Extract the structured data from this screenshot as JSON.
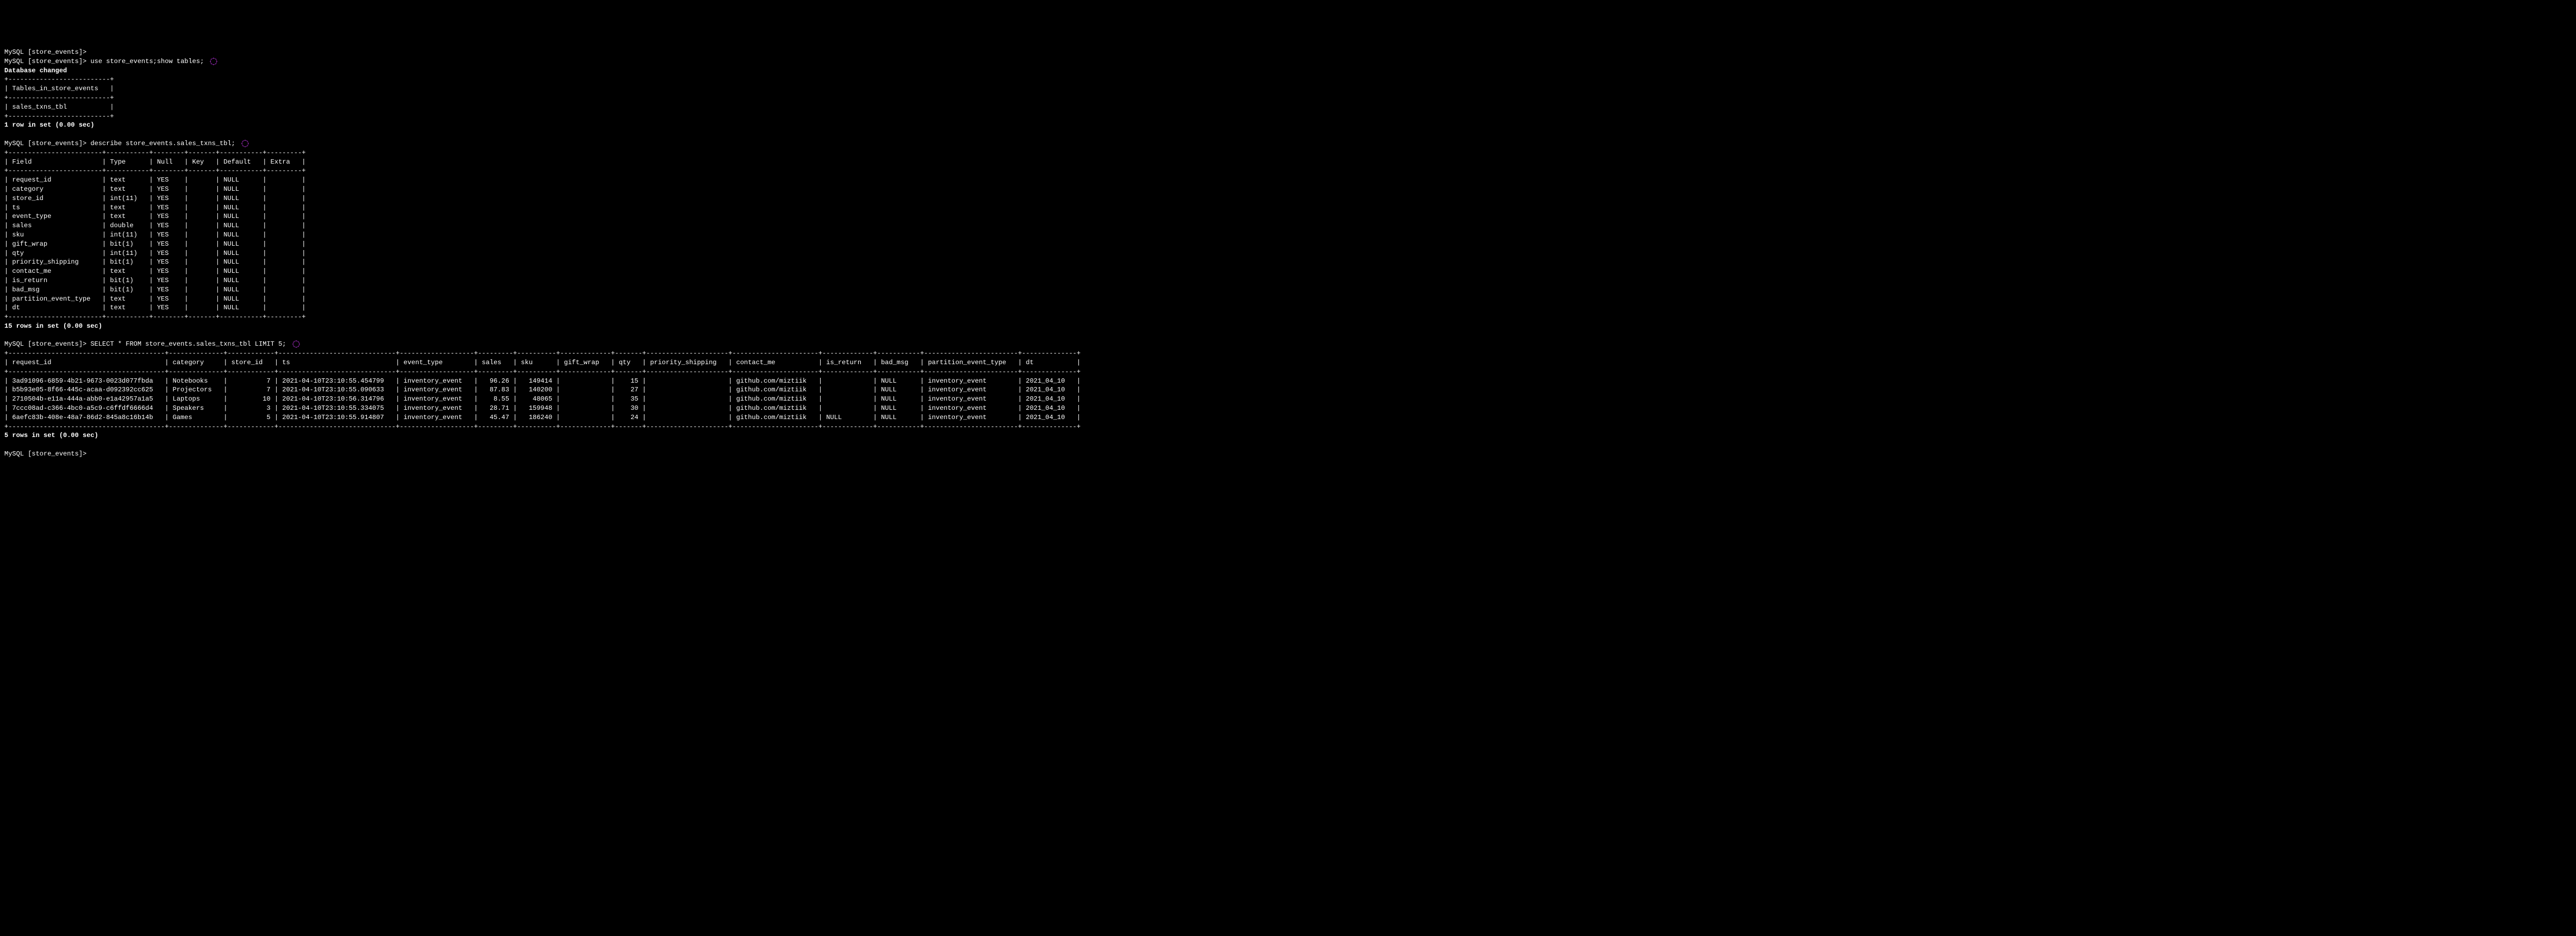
{
  "prompt": "MySQL [store_events]>",
  "spinner_color": "#d63aff",
  "cmd1": {
    "command": "use store_events;show tables;",
    "result_line": "Database changed",
    "table_header": "Tables_in_store_events",
    "table_row": "sales_txns_tbl",
    "footer": "1 row in set (0.00 sec)"
  },
  "cmd2": {
    "command": "describe store_events.sales_txns_tbl;",
    "headers": [
      "Field",
      "Type",
      "Null",
      "Key",
      "Default",
      "Extra"
    ],
    "rows": [
      [
        "request_id",
        "text",
        "YES",
        "",
        "NULL",
        ""
      ],
      [
        "category",
        "text",
        "YES",
        "",
        "NULL",
        ""
      ],
      [
        "store_id",
        "int(11)",
        "YES",
        "",
        "NULL",
        ""
      ],
      [
        "ts",
        "text",
        "YES",
        "",
        "NULL",
        ""
      ],
      [
        "event_type",
        "text",
        "YES",
        "",
        "NULL",
        ""
      ],
      [
        "sales",
        "double",
        "YES",
        "",
        "NULL",
        ""
      ],
      [
        "sku",
        "int(11)",
        "YES",
        "",
        "NULL",
        ""
      ],
      [
        "gift_wrap",
        "bit(1)",
        "YES",
        "",
        "NULL",
        ""
      ],
      [
        "qty",
        "int(11)",
        "YES",
        "",
        "NULL",
        ""
      ],
      [
        "priority_shipping",
        "bit(1)",
        "YES",
        "",
        "NULL",
        ""
      ],
      [
        "contact_me",
        "text",
        "YES",
        "",
        "NULL",
        ""
      ],
      [
        "is_return",
        "bit(1)",
        "YES",
        "",
        "NULL",
        ""
      ],
      [
        "bad_msg",
        "bit(1)",
        "YES",
        "",
        "NULL",
        ""
      ],
      [
        "partition_event_type",
        "text",
        "YES",
        "",
        "NULL",
        ""
      ],
      [
        "dt",
        "text",
        "YES",
        "",
        "NULL",
        ""
      ]
    ],
    "footer": "15 rows in set (0.00 sec)"
  },
  "cmd3": {
    "command": "SELECT * FROM store_events.sales_txns_tbl LIMIT 5;",
    "headers": [
      "request_id",
      "category",
      "store_id",
      "ts",
      "event_type",
      "sales",
      "sku",
      "gift_wrap",
      "qty",
      "priority_shipping",
      "contact_me",
      "is_return",
      "bad_msg",
      "partition_event_type",
      "dt"
    ],
    "rows": [
      [
        "3ad91096-6859-4b21-9673-0023d077fbda",
        "Notebooks",
        "7",
        "2021-04-10T23:10:55.454799",
        "inventory_event",
        "96.26",
        "149414",
        "",
        "15",
        "",
        "github.com/miztiik",
        "",
        "NULL",
        "inventory_event",
        "2021_04_10"
      ],
      [
        "b5b93e05-8f66-445c-acaa-d092392cc625",
        "Projectors",
        "7",
        "2021-04-10T23:10:55.090633",
        "inventory_event",
        "87.83",
        "140200",
        "",
        "27",
        "",
        "github.com/miztiik",
        "",
        "NULL",
        "inventory_event",
        "2021_04_10"
      ],
      [
        "2710504b-e11a-444a-abb0-e1a42957a1a5",
        "Laptops",
        "10",
        "2021-04-10T23:10:56.314796",
        "inventory_event",
        "8.55",
        "48065",
        "",
        "35",
        "",
        "github.com/miztiik",
        "",
        "NULL",
        "inventory_event",
        "2021_04_10"
      ],
      [
        "7ccc08ad-c366-4bc0-a5c9-c6ffdf6666d4",
        "Speakers",
        "3",
        "2021-04-10T23:10:55.334075",
        "inventory_event",
        "28.71",
        "159948",
        "",
        "30",
        "",
        "github.com/miztiik",
        "",
        "NULL",
        "inventory_event",
        "2021_04_10"
      ],
      [
        "6aefc83b-408e-48a7-86d2-845a8c16b14b",
        "Games",
        "5",
        "2021-04-10T23:10:55.914807",
        "inventory_event",
        "45.47",
        "186240",
        "",
        "24",
        "",
        "github.com/miztiik",
        "NULL",
        "NULL",
        "inventory_event",
        "2021_04_10"
      ]
    ],
    "footer": "5 rows in set (0.00 sec)"
  },
  "col_widths": {
    "tables": [
      24
    ],
    "describe": [
      22,
      9,
      6,
      5,
      9,
      7
    ],
    "select": [
      38,
      12,
      10,
      28,
      17,
      7,
      8,
      11,
      5,
      19,
      20,
      11,
      9,
      22,
      12
    ]
  },
  "alignment": {
    "select": [
      "L",
      "L",
      "R",
      "L",
      "L",
      "R",
      "R",
      "L",
      "R",
      "L",
      "L",
      "L",
      "L",
      "L",
      "L"
    ]
  }
}
